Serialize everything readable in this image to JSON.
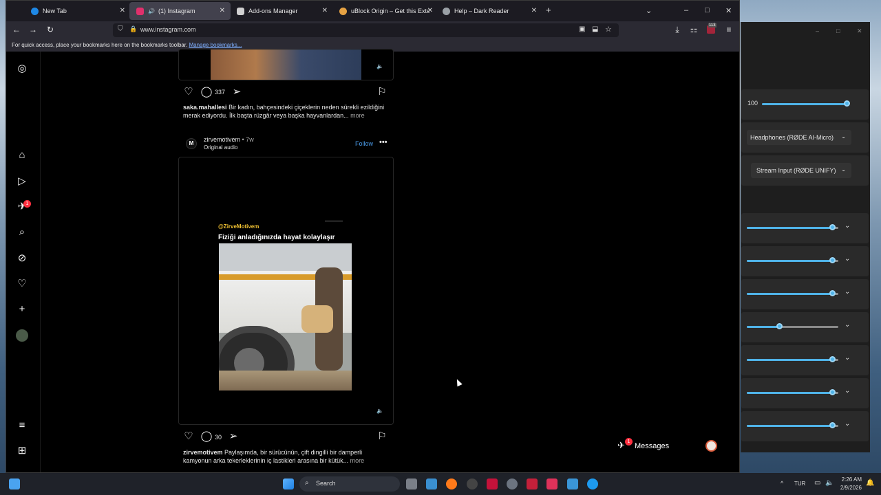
{
  "tabs": [
    {
      "label": "New Tab",
      "active": false,
      "color": "#1e88e5"
    },
    {
      "label": "(1) Instagram",
      "active": true,
      "color": "#e1306c"
    },
    {
      "label": "Add-ons Manager",
      "active": false,
      "color": "#cccccc"
    },
    {
      "label": "uBlock Origin – Get this Extensi",
      "active": false,
      "color": "#e6a243"
    },
    {
      "label": "Help – Dark Reader",
      "active": false,
      "color": "#9aa0a6"
    }
  ],
  "url": "www.instagram.com",
  "extension_badge": "113",
  "bookmarks_text": "For quick access, place your bookmarks here on the bookmarks toolbar.",
  "bookmarks_link": "Manage bookmarks...",
  "post1": {
    "comments": "337",
    "user": "saka.mahallesi",
    "caption": "Bir kadın, bahçesindeki çiçeklerin neden sürekli ezildiğini merak ediyordu. İlk başta rüzgâr veya başka hayvanlardan...",
    "more": "more"
  },
  "post2": {
    "user": "zirvemotivem",
    "time": "• 7w",
    "audio": "Original audio",
    "follow": "Follow",
    "overlay_handle": "@ZirveMotivem",
    "overlay_title": "Fiziği anladığınızda hayat kolaylaşır",
    "comments": "30",
    "caption_user": "zirvemotivem",
    "caption": "Paylaşımda, bir sürücünün, çift dingilli bir damperli kamyonun arka tekerleklerinin iç lastikleri arasına bir kütük...",
    "more": "more"
  },
  "notif_badge": "1",
  "messages": {
    "label": "Messages",
    "badge": "1"
  },
  "mixer": {
    "volume": "100",
    "output": "Headphones (RØDE AI-Micro)",
    "input": "Stream Input (RØDE UNIFY)",
    "levels": [
      0.94,
      0.94,
      0.94,
      0.36,
      0.94,
      0.94,
      0.94
    ]
  },
  "taskbar": {
    "search": "Search",
    "lang": "TUR",
    "time": "2:26 AM",
    "date": "2/9/2026"
  }
}
